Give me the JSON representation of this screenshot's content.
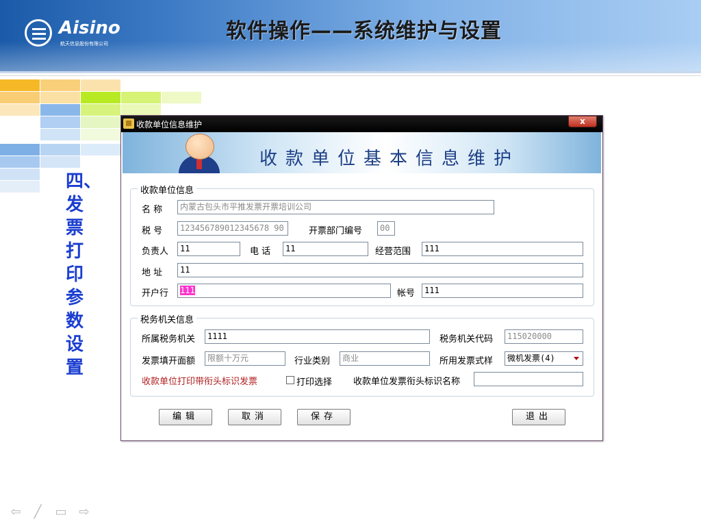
{
  "slide": {
    "title": "软件操作——系统维护与设置",
    "logo_text": "Aisino",
    "logo_sub": "航天信息股份有限公司",
    "side_label": [
      "四、",
      "发",
      "票",
      "打",
      "印",
      "参",
      "数",
      "设",
      "置"
    ]
  },
  "dialog": {
    "window_title": "收款单位信息维护",
    "close_label": "x",
    "banner_title": "收款单位基本信息维护",
    "payee_group": {
      "title": "收款单位信息",
      "name_label": "名 称",
      "name_value": "内蒙古包头市平推发票开票培训公司",
      "tax_no_label": "税 号",
      "tax_no_value": "123456789012345678 90",
      "dept_code_label": "开票部门编号",
      "dept_code_value": "00",
      "person_label": "负责人",
      "person_value": "11",
      "phone_label": "电 话",
      "phone_value": "11",
      "scope_label": "经营范围",
      "scope_value": "111",
      "address_label": "地 址",
      "address_value": "11",
      "bank_label": "开户行",
      "bank_value": "111",
      "account_label": "帐号",
      "account_value": "111"
    },
    "tax_group": {
      "title": "税务机关信息",
      "authority_label": "所属税务机关",
      "authority_value": "1111",
      "authority_code_label": "税务机关代码",
      "authority_code_value": "115020000",
      "limit_label": "发票填开面额",
      "limit_value": "限额十万元",
      "industry_label": "行业类别",
      "industry_value": "商业",
      "style_label": "所用发票式样",
      "style_value": "微机发票(4)",
      "print_header_label": "收款单位打印带衔头标识发票",
      "print_select_label": "打印选择",
      "print_select_checked": false,
      "header_name_label": "收款单位发票衔头标识名称",
      "header_name_value": ""
    },
    "buttons": {
      "edit": "编辑",
      "cancel": "取消",
      "save": "保存",
      "exit": "退出"
    }
  },
  "nav": {
    "icons": [
      "prev-arrow-icon",
      "pen-icon",
      "menu-icon",
      "next-arrow-icon"
    ]
  }
}
